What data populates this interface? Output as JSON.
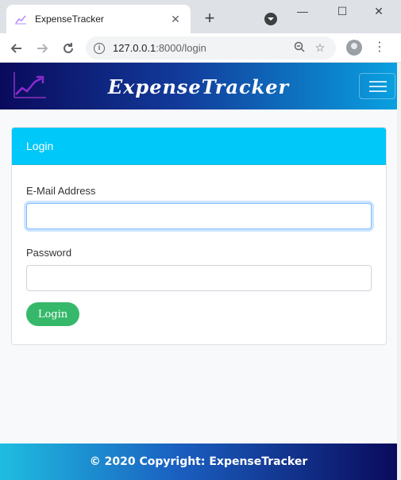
{
  "browser": {
    "tab_title": "ExpenseTracker",
    "new_tab_glyph": "+",
    "close_glyph": "✕",
    "url_host": "127.0.0.1",
    "url_rest": ":8000/login",
    "window_controls": {
      "minimize": "—",
      "maximize": "☐",
      "close": "✕"
    },
    "nav_icons": {
      "back": "back-arrow-icon",
      "forward": "forward-arrow-icon",
      "reload": "reload-icon"
    },
    "omnibox_icons": {
      "zoom": "zoom-out-icon",
      "bookmark": "star-icon"
    }
  },
  "navbar": {
    "brand": "ExpenseTracker",
    "logo_icon": "trend-chart-icon"
  },
  "login_card": {
    "header": "Login",
    "email_label": "E-Mail Address",
    "email_value": "",
    "password_label": "Password",
    "password_value": "",
    "submit_label": "Login"
  },
  "footer": {
    "text": "© 2020 Copyright: ExpenseTracker"
  },
  "colors": {
    "card_header": "#00c8f8",
    "login_button": "#36b86a",
    "navbar_start": "#0a0a5c",
    "navbar_end": "#0aa0e0"
  }
}
